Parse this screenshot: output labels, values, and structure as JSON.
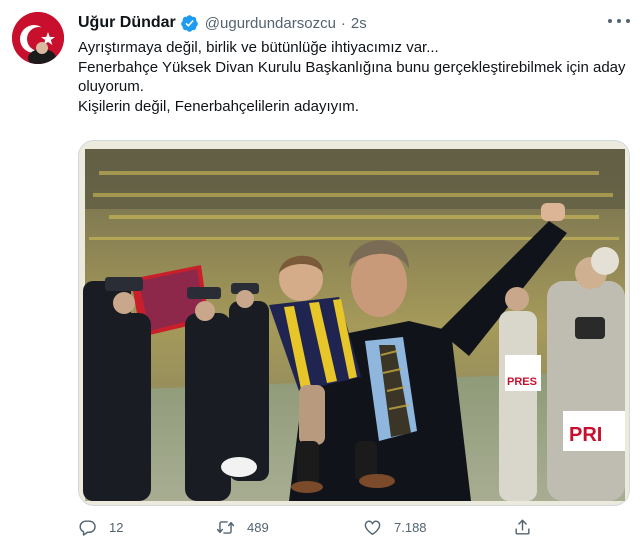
{
  "author": {
    "display_name": "Uğur Dündar",
    "handle": "@ugurdundarsozcu",
    "separator": "·",
    "time": "2s",
    "verified": true
  },
  "tweet": {
    "lines": [
      "Ayrıştırmaya değil, birlik ve bütünlüğe ihtiyacımız var...",
      "Fenerbahçe Yüksek Divan Kurulu Başkanlığına bunu gerçekleştirebilmek için aday oluyorum.",
      "Kişilerin değil, Fenerbahçelilerin adayıyım."
    ]
  },
  "media": {
    "photo_text": "PRES",
    "photo_text_2": "PRI"
  },
  "actions": {
    "reply_count": "12",
    "retweet_count": "489",
    "like_count": "7.188"
  },
  "icons": {
    "verified": "verified-badge-icon",
    "more": "more-options-icon",
    "reply": "reply-icon",
    "retweet": "retweet-icon",
    "like": "heart-icon",
    "share": "share-icon"
  },
  "colors": {
    "verified_blue": "#1d9bf0",
    "secondary_text": "#536471",
    "primary_text": "#0f1419",
    "avatar_red": "#c8102e"
  }
}
